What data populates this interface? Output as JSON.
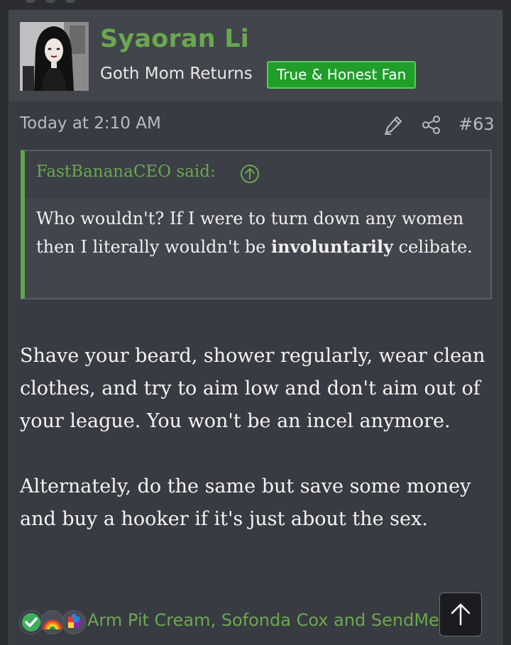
{
  "post": {
    "author": {
      "username": "Syaoran Li",
      "user_title": "Goth Mom Returns",
      "banner": "True & Honest Fan",
      "avatar_icon": "avatar-portrait"
    },
    "meta": {
      "date": "Today at 2:10 AM",
      "post_number": "#63",
      "edit_icon": "pencil-icon",
      "share_icon": "share-icon"
    },
    "quote": {
      "attribution": "FastBananaCEO said:",
      "jump_icon": "arrow-up-circle-icon",
      "text_before": "Who wouldn't? If I were to turn down any women then I literally wouldn't be ",
      "text_bold": "involuntarily",
      "text_after": " celibate."
    },
    "body": {
      "paragraph_1": "Shave your beard, shower regularly, wear clean clothes, and try to aim low and don't aim out of your league. You won't be an incel anymore.",
      "paragraph_2": "Alternately, do the same but save some money and buy a hooker if it's just about the sex."
    },
    "reactions": {
      "icons": [
        "check-reaction-icon",
        "rainbow-reaction-icon",
        "puzzle-reaction-icon"
      ],
      "list": "Arm Pit Cream, Sofonda Cox and SendMe"
    }
  },
  "colors": {
    "accent_green": "#6aa84f",
    "banner_green": "#1f9e2a",
    "post_bg": "#393b42",
    "header_bg": "#42454c"
  },
  "scroll_top_icon": "arrow-up-icon"
}
